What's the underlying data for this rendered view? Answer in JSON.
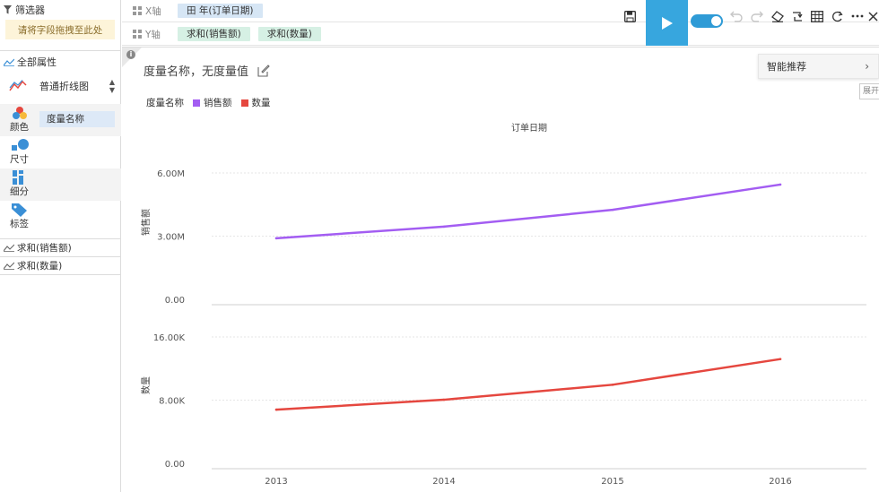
{
  "filter": {
    "title": "筛选器",
    "placeholder": "请将字段拖拽至此处"
  },
  "properties": {
    "title": "全部属性",
    "chart_type": "普通折线图",
    "marks": [
      {
        "label": "颜色",
        "chip": "度量名称"
      },
      {
        "label": "尺寸"
      },
      {
        "label": "细分"
      },
      {
        "label": "标签"
      }
    ],
    "measures": [
      "求和(销售额)",
      "求和(数量)"
    ]
  },
  "shelves": {
    "x": {
      "label": "X轴",
      "fields": [
        "田 年(订单日期)"
      ]
    },
    "y": {
      "label": "Y轴",
      "fields": [
        "求和(销售额)",
        "求和(数量)"
      ]
    }
  },
  "toolbar": {
    "icons": [
      "save-icon",
      "play-icon",
      "toggle-switch",
      "undo-icon",
      "redo-icon",
      "eraser-icon",
      "swap-axes-icon",
      "table-icon",
      "refresh-icon",
      "more-icon",
      "close-icon"
    ],
    "accent": "#37a6de"
  },
  "chart_title": "度量名称，无度量值",
  "recommend": {
    "label": "智能推荐",
    "tooltip": "展开"
  },
  "legend": {
    "title": "度量名称",
    "items": [
      {
        "name": "销售额",
        "color": "#a35df2"
      },
      {
        "name": "数量",
        "color": "#e5473f"
      }
    ]
  },
  "chart_data": {
    "type": "line",
    "x_title": "订单日期",
    "categories": [
      "2013",
      "2014",
      "2015",
      "2016"
    ],
    "panels": [
      {
        "series": "销售额",
        "ylabel": "销售额",
        "values": [
          2900000,
          3450000,
          4250000,
          5450000
        ],
        "ylim": [
          0,
          6000000
        ],
        "ticks": [
          "0.00",
          "3.00M",
          "6.00M"
        ],
        "color": "#a35df2"
      },
      {
        "series": "数量",
        "ylabel": "数量",
        "values": [
          6800,
          8050,
          9950,
          13200
        ],
        "ylim": [
          0,
          16000
        ],
        "ticks": [
          "0.00",
          "8.00K",
          "16.00K"
        ],
        "color": "#e5473f"
      }
    ]
  }
}
